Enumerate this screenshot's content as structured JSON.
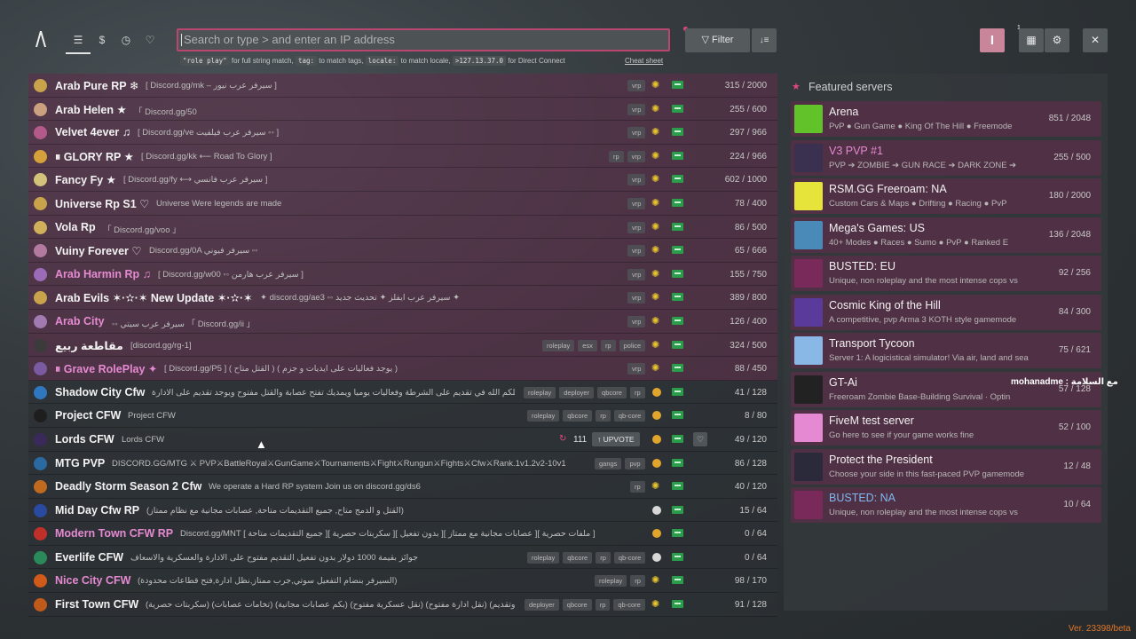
{
  "nav": {
    "icons": [
      "list-icon",
      "dollar-icon",
      "history-icon",
      "heart-icon"
    ],
    "dollar_label": "$"
  },
  "search": {
    "placeholder": "Search or type > and enter an IP address",
    "hint_rp": "\"role play\"",
    "hint_rp_text": "for full string match,",
    "hint_tag": "tag:",
    "hint_tag_text": "to match tags,",
    "hint_locale": "locale:",
    "hint_locale_text": "to match locale,",
    "hint_ip": ">127.13.37.0",
    "hint_ip_text": "for Direct Connect",
    "cheat_sheet": "Cheat sheet"
  },
  "toolbar": {
    "filter_label": "Filter",
    "badge_count": "1"
  },
  "servers": [
    {
      "name": "Arab Pure RP ❄",
      "desc": "[ Discord.gg/mk – سيرفر عرب نيور ]",
      "tags": [
        "vrp"
      ],
      "count": "315 / 2000",
      "premium": true,
      "icon_color": "#c9a24c"
    },
    {
      "name": "Arab Helen ★",
      "desc": "「 Discord.gg/50",
      "tags": [
        "vrp"
      ],
      "count": "255 / 600",
      "premium": true,
      "icon_color": "#caa07e"
    },
    {
      "name": "Velvet 4ever ♫",
      "desc": "[ Discord.gg/ve سيرفر عرب فيلفيت ◦◦ ]",
      "tags": [
        "vrp"
      ],
      "count": "297 / 966",
      "premium": true,
      "icon_color": "#b45a8a"
    },
    {
      "name": "⏸ GLORY RP ★",
      "desc": "[ Discord.gg/kk ⟵ Road To Glory ]",
      "tags": [
        "rp",
        "vrp"
      ],
      "count": "224 / 966",
      "premium": true,
      "icon_color": "#d6a03a"
    },
    {
      "name": "Fancy Fy ★",
      "desc": "[ Discord.gg/fy ⟷ سيرفر عرب فانسي ]",
      "tags": [
        "vrp"
      ],
      "count": "602 / 1000",
      "premium": true,
      "icon_color": "#d2c27a"
    },
    {
      "name": "Universe Rp S1 ♡",
      "desc": "Universe Were legends are made",
      "tags": [
        "vrp"
      ],
      "count": "78 / 400",
      "premium": true,
      "icon_color": "#c9a24c"
    },
    {
      "name": "Vola Rp",
      "desc": "「 Discord.gg/voo 」",
      "tags": [
        "vrp"
      ],
      "count": "86 / 500",
      "premium": true,
      "icon_color": "#d0b05a"
    },
    {
      "name": "Vuiny Forever ♡",
      "desc": "Discord.gg/0A سيرفر فيوني ◦◦",
      "tags": [
        "vrp"
      ],
      "count": "65 / 666",
      "premium": true,
      "icon_color": "#b37aa0"
    },
    {
      "name": "Arab Harmin Rp ♫",
      "desc": "[ Discord.gg/w00 ◦◦ سيرفر عرب هارمن ]",
      "tags": [
        "vrp"
      ],
      "count": "155 / 750",
      "premium": true,
      "pink": true,
      "icon_color": "#9c6bb8"
    },
    {
      "name": "Arab Evils ✶·✫·✶ New Update ✶·✫·✶",
      "desc": "✦ discord.gg/ae3 ◦◦ سيرفر عرب ايفلز ✦ تحديث جديد ✦",
      "tags": [
        "vrp"
      ],
      "count": "389 / 800",
      "premium": true,
      "icon_color": "#c9a24c"
    },
    {
      "name": "Arab City",
      "desc": "◦◦ سيرفر عرب سيتي 「 Discord.gg/ii 」",
      "tags": [
        "vrp"
      ],
      "count": "126 / 400",
      "premium": true,
      "pink": true,
      "icon_color": "#a07ab0"
    },
    {
      "name": "مقاطعة ربيع",
      "desc": "[discord.gg/rg-1]",
      "tags": [
        "roleplay",
        "esx",
        "rp",
        "police"
      ],
      "count": "324 / 500",
      "premium": true,
      "icon_color": "#3b3b3b"
    },
    {
      "name": "⏸ Grave RolePlay ✦",
      "desc": "[ Discord.gg/P5 ] ( القتل متاح ) ( يوجد فعاليات على ايديات و جزم )",
      "tags": [
        "vrp"
      ],
      "count": "88 / 450",
      "premium": true,
      "pink": true,
      "icon_color": "#7a5aa0"
    },
    {
      "name": "Shadow City Cfw",
      "desc": "جبلكم الله في تقديم على الشرطة وفعاليات يوميا ويمديك تفتح عصابة والقتل مفتوح ويوجد تقديم على الادارة",
      "tags": [
        "roleplay",
        "deployer",
        "qbcore",
        "rp"
      ],
      "count": "41 / 128",
      "premium": false,
      "circle": "#e2a52c",
      "icon_color": "#2f78c0"
    },
    {
      "name": "Project CFW",
      "desc": "Project CFW",
      "tags": [
        "roleplay",
        "qbcore",
        "rp",
        "qb-core"
      ],
      "count": "8 / 80",
      "premium": false,
      "circle": "#e2a52c",
      "icon_color": "#1e1e1e"
    },
    {
      "name": "Lords CFW",
      "desc": "Lords CFW",
      "tags": [],
      "count": "49 / 120",
      "premium": false,
      "circle": "#e2a52c",
      "icon_color": "#3a2a5a",
      "upvote": true,
      "upvotes": "111",
      "upvote_label": "UPVOTE"
    },
    {
      "name": "MTG PVP",
      "desc": "DISCORD.GG/MTG ⚔ PVP⚔BattleRoyal⚔GunGame⚔Tournaments⚔Fight⚔Rungun⚔Fights⚔Cfw⚔Rank.1v1.2v2-10v1",
      "tags": [
        "gangs",
        "pvp"
      ],
      "count": "86 / 128",
      "premium": false,
      "circle": "#e2a52c",
      "icon_color": "#2a6aa0"
    },
    {
      "name": "Deadly Storm Season 2 Cfw",
      "desc": "We operate a Hard RP system Join us on discord.gg/ds6",
      "tags": [
        "rp"
      ],
      "count": "40 / 120",
      "premium": false,
      "circle": "sun",
      "icon_color": "#c06a20"
    },
    {
      "name": "Mid Day Cfw RP",
      "desc": "(القتل و الدمج متاح, جميع التقديمات متاحة, عصابات مجانية مع نظام ممتاز)",
      "tags": [],
      "count": "15 / 64",
      "premium": false,
      "circle": "#d8d8d8",
      "icon_color": "#2a4aa0"
    },
    {
      "name": "Modern Town CFW RP",
      "desc": "Discord.gg/MNT [ جميع التقديمات متاحة ][ سكربتات حصرية ][ بدون تفعيل ][ عصابات مجانية مع ممتاز ][ ملفات حصرية ]",
      "tags": [],
      "count": "0 / 64",
      "premium": false,
      "pink_name": true,
      "circle": "#e2a52c",
      "icon_color": "#c0302a"
    },
    {
      "name": "Everlife CFW",
      "desc": "جوائز بقيمة 1000 دولار بدون تفعيل التقديم مفتوح على الادارة والعسكرية والاسعاف",
      "tags": [
        "roleplay",
        "qbcore",
        "rp",
        "qb-core"
      ],
      "count": "0 / 64",
      "premium": false,
      "circle": "#d8d8d8",
      "icon_color": "#2a8a5a"
    },
    {
      "name": "Nice City CFW",
      "desc": "(السيرفر بنضام التفعيل سوتي,جرب ممتاز,نظل ادارة,فتح قطاعات محدودة)",
      "tags": [
        "roleplay",
        "rp"
      ],
      "count": "98 / 170",
      "premium": false,
      "pink_name": true,
      "circle": "sun",
      "icon_color": "#d05a1a"
    },
    {
      "name": "First Town CFW",
      "desc": "(سكربتات حصرية) (تخامات عصابات) (بكم عصابات مجانية) (نقل عسكرية مفتوح) (نقل ادارة مفتوح) (نقل وتقديم)",
      "tags": [
        "deployer",
        "qbcore",
        "rp",
        "qb-core"
      ],
      "count": "91 / 128",
      "premium": false,
      "circle": "sun",
      "icon_color": "#c05a1a"
    }
  ],
  "featured": {
    "heading": "Featured servers",
    "cards": [
      {
        "title": "Arena",
        "desc": "PvP ● Gun Game ● King Of The Hill ● Freemode",
        "count": "851 / 2048",
        "icon_color": "#62c22a",
        "icon": "arena-logo-icon"
      },
      {
        "title": "V3 PVP #1",
        "title_color": "#e58ad2",
        "desc": "PVP ➔ ZOMBIE ➔ GUN RACE ➔ DARK ZONE ➔",
        "count": "255 / 500",
        "icon_color": "#3a3050",
        "icon": "v3-logo-icon"
      },
      {
        "title": "RSM.GG Freeroam: NA",
        "desc": "Custom Cars & Maps ● Drifting ● Racing ● PvP",
        "count": "180 / 2000",
        "icon_color": "#e6e43a",
        "icon": "rsm-logo-icon"
      },
      {
        "title": "Mega's Games: US",
        "desc": "40+ Modes ● Races ● Sumo ● PvP ● Ranked E",
        "count": "136 / 2048",
        "icon_color": "#4a8ab8",
        "icon": "megas-logo-icon"
      },
      {
        "title": "BUSTED: EU",
        "desc": "Unique, non roleplay and the most intense cops vs",
        "count": "92 / 256",
        "icon_color": "#7a2a5a",
        "icon": "busted-logo-icon"
      },
      {
        "title": "Cosmic King of the Hill",
        "desc": "A competitive, pvp Arma 3 KOTH style gamemode",
        "count": "84 / 300",
        "icon_color": "#5a3a9a",
        "icon": "cosmic-logo-icon"
      },
      {
        "title": "Transport Tycoon",
        "desc": "Server 1: A logicistical simulator! Via air, land and sea",
        "count": "75 / 621",
        "icon_color": "#8ab8e6",
        "icon": "transport-logo-icon"
      },
      {
        "title": "GT-Ai",
        "desc": "Freeroam Zombie Base-Building Survival · Optin",
        "count": "57 / 128",
        "icon_color": "#222222",
        "icon": "gtai-logo-icon"
      },
      {
        "title": "FiveM test server",
        "desc": "Go here to see if your game works fine",
        "count": "52 / 100",
        "icon_color": "#e58ad2",
        "icon": "fivem-logo-icon"
      },
      {
        "title": "Protect the President",
        "desc": "Choose your side in this fast-paced PVP gamemode",
        "count": "12 / 48",
        "icon_color": "#2a2a3a",
        "icon": "ptp-logo-icon"
      },
      {
        "title": "BUSTED: NA",
        "title_color": "#7fb8f0",
        "desc": "Unique, non roleplay and the most intense cops vs",
        "count": "10 / 64",
        "icon_color": "#7a2a5a",
        "icon": "busted-logo-icon"
      }
    ]
  },
  "overlay_chat": "mohanadme : مع السلامة",
  "version": "Ver. 23398/beta",
  "colors": {
    "accent": "#b8466f",
    "premium_row": "#5c2e48",
    "server_green": "#2a9d4b"
  }
}
